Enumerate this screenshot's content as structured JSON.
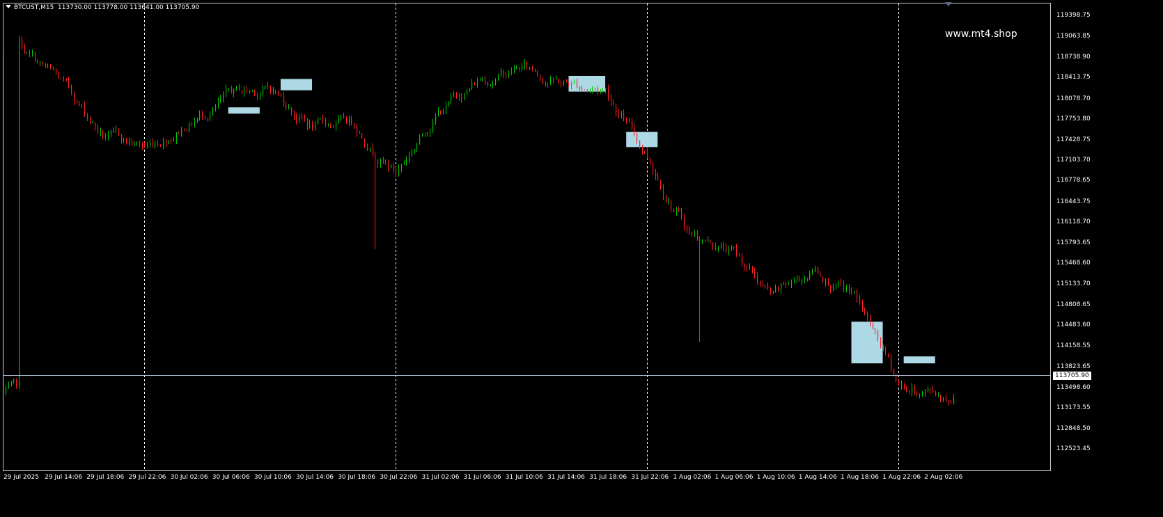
{
  "header": {
    "symbol_tf": "BTCUST,M15",
    "ohlc": "113730.00 113778.00 113641.00 113705.90"
  },
  "watermark": "www.mt4.shop",
  "current_price": "113705.90",
  "colors": {
    "background": "#000000",
    "up_candle": "#00c800",
    "down_candle": "#ff2020",
    "zone_fill": "#add8e6",
    "signal_blue": "#1e90ff",
    "grid_line": "#ffffff",
    "price_line": "#b4c8dc"
  },
  "price_axis_labels": [
    "119398.75",
    "119063.85",
    "118738.90",
    "118413.75",
    "118078.70",
    "117753.80",
    "117428.75",
    "117103.70",
    "116778.65",
    "116443.75",
    "116118.70",
    "115793.65",
    "115468.60",
    "115133.70",
    "114808.65",
    "114483.60",
    "114158.55",
    "113823.65",
    "113498.60",
    "113173.55",
    "112848.50",
    "112523.45"
  ],
  "time_axis_labels": [
    "29 Jul 2025",
    "29 Jul 14:06",
    "29 Jul 18:06",
    "29 Jul 22:06",
    "30 Jul 02:06",
    "30 Jul 06:06",
    "30 Jul 10:06",
    "30 Jul 14:06",
    "30 Jul 18:06",
    "30 Jul 22:06",
    "31 Jul 02:06",
    "31 Jul 06:06",
    "31 Jul 10:06",
    "31 Jul 14:06",
    "31 Jul 18:06",
    "31 Jul 22:06",
    "1 Aug 02:06",
    "1 Aug 06:06",
    "1 Aug 10:06",
    "1 Aug 14:06",
    "1 Aug 18:06",
    "1 Aug 22:06",
    "2 Aug 02:06"
  ],
  "chart_data": {
    "type": "candlestick",
    "timeframe": "M15",
    "ylim": [
      112400,
      119600
    ],
    "day_separators": [
      "29 Jul 22:06",
      "30 Jul 22:06",
      "31 Jul 22:06",
      "1 Aug 22:06"
    ],
    "path_keypoints": [
      [
        "29 Jul 2025",
        118850
      ],
      [
        "29 Jul 14:06",
        118300
      ],
      [
        "29 Jul 18:06",
        117500
      ],
      [
        "29 Jul 22:06",
        117300
      ],
      [
        "30 Jul 02:06",
        117750
      ],
      [
        "30 Jul 06:06",
        118100
      ],
      [
        "30 Jul 10:06",
        118250
      ],
      [
        "30 Jul 14:06",
        117650
      ],
      [
        "30 Jul 18:06",
        117700
      ],
      [
        "30 Jul 22:06",
        116950
      ],
      [
        "31 Jul 02:06",
        117900
      ],
      [
        "31 Jul 06:06",
        118400
      ],
      [
        "31 Jul 10:06",
        118600
      ],
      [
        "31 Jul 14:06",
        118350
      ],
      [
        "31 Jul 18:06",
        118250
      ],
      [
        "31 Jul 22:06",
        117200
      ],
      [
        "1 Aug 02:06",
        116000
      ],
      [
        "1 Aug 06:06",
        115700
      ],
      [
        "1 Aug 10:06",
        114900
      ],
      [
        "1 Aug 14:06",
        115400
      ],
      [
        "1 Aug 18:06",
        114900
      ],
      [
        "1 Aug 22:06",
        113500
      ],
      [
        "2 Aug 02:06",
        113400
      ]
    ],
    "spikes": [
      {
        "time": "30 Jul 20:06",
        "low": 115700
      },
      {
        "time": "1 Aug 03:06",
        "low": 114230
      }
    ],
    "zones": [
      {
        "t0": "30 Jul 06:06",
        "t1": "30 Jul 09:06",
        "p_high": 117950,
        "p_low": 117850
      },
      {
        "t0": "30 Jul 11:06",
        "t1": "30 Jul 14:06",
        "p_high": 118400,
        "p_low": 118220
      },
      {
        "t0": "31 Jul 14:36",
        "t1": "31 Jul 18:06",
        "p_high": 118450,
        "p_low": 118200
      },
      {
        "t0": "31 Jul 20:06",
        "t1": "31 Jul 23:06",
        "p_high": 117560,
        "p_low": 117320
      },
      {
        "t0": "1 Aug 17:36",
        "t1": "1 Aug 20:36",
        "p_high": 114550,
        "p_low": 113890
      },
      {
        "t0": "1 Aug 22:36",
        "t1": "2 Aug 01:36",
        "p_high": 114000,
        "p_low": 113890
      }
    ]
  }
}
